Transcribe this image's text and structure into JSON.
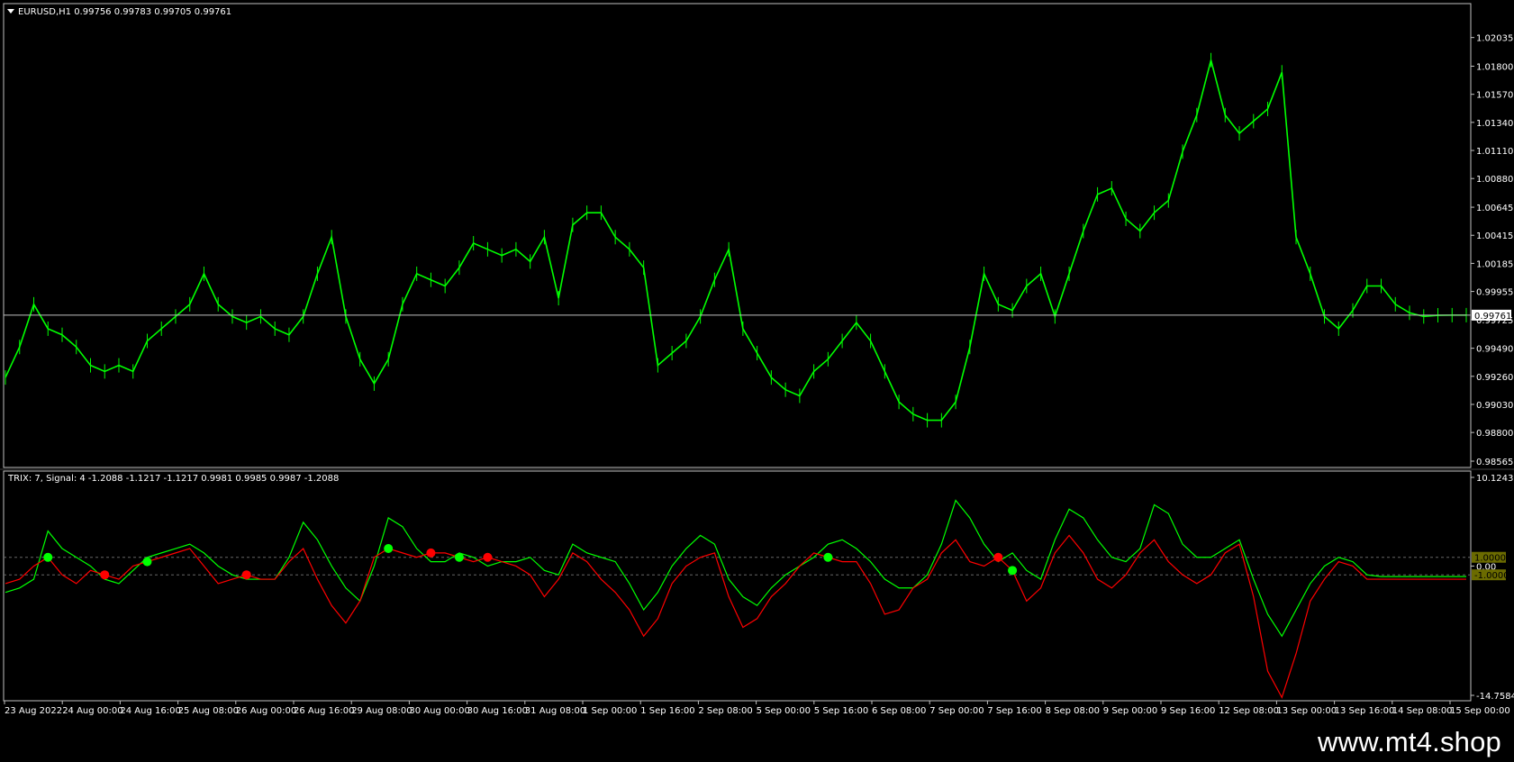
{
  "chart_data": [
    {
      "type": "line",
      "title": "EURUSD,H1  0.99756 0.99783 0.99705 0.99761",
      "symbol": "EURUSD,H1",
      "ohlc": "0.99756 0.99783 0.99705 0.99761",
      "ylim": [
        0.98565,
        1.0218
      ],
      "y_ticks": [
        "1.02035",
        "1.01800",
        "1.01570",
        "1.01340",
        "1.01110",
        "1.00880",
        "1.00645",
        "1.00415",
        "1.00185",
        "0.99955",
        "0.99725",
        "0.99490",
        "0.99260",
        "0.99030",
        "0.98800",
        "0.98565"
      ],
      "current_price": "0.99761",
      "series": [
        {
          "color": "#00ff00",
          "x": [
            "23 Aug 00:00",
            "23 Aug 04:00",
            "23 Aug 08:00",
            "23 Aug 12:00",
            "23 Aug 16:00",
            "23 Aug 20:00",
            "24 Aug 00:00",
            "24 Aug 04:00",
            "24 Aug 08:00",
            "24 Aug 12:00",
            "24 Aug 16:00",
            "24 Aug 20:00",
            "25 Aug 00:00",
            "25 Aug 04:00",
            "25 Aug 08:00",
            "25 Aug 12:00",
            "25 Aug 16:00",
            "25 Aug 20:00",
            "26 Aug 00:00",
            "26 Aug 04:00",
            "26 Aug 08:00",
            "26 Aug 12:00",
            "26 Aug 16:00",
            "26 Aug 20:00",
            "29 Aug 00:00",
            "29 Aug 04:00",
            "29 Aug 08:00",
            "29 Aug 12:00",
            "29 Aug 16:00",
            "29 Aug 20:00",
            "30 Aug 00:00",
            "30 Aug 04:00",
            "30 Aug 08:00",
            "30 Aug 12:00",
            "30 Aug 16:00",
            "30 Aug 20:00",
            "31 Aug 00:00",
            "31 Aug 04:00",
            "31 Aug 08:00",
            "31 Aug 12:00",
            "31 Aug 16:00",
            "31 Aug 20:00",
            "1 Sep 00:00",
            "1 Sep 04:00",
            "1 Sep 08:00",
            "1 Sep 12:00",
            "1 Sep 16:00",
            "1 Sep 20:00",
            "2 Sep 00:00",
            "2 Sep 04:00",
            "2 Sep 08:00",
            "2 Sep 12:00",
            "2 Sep 16:00",
            "2 Sep 20:00",
            "5 Sep 00:00",
            "5 Sep 04:00",
            "5 Sep 08:00",
            "5 Sep 12:00",
            "5 Sep 16:00",
            "5 Sep 20:00",
            "6 Sep 00:00",
            "6 Sep 04:00",
            "6 Sep 08:00",
            "6 Sep 12:00",
            "6 Sep 16:00",
            "6 Sep 20:00",
            "7 Sep 00:00",
            "7 Sep 04:00",
            "7 Sep 08:00",
            "7 Sep 12:00",
            "7 Sep 16:00",
            "7 Sep 20:00",
            "8 Sep 00:00",
            "8 Sep 04:00",
            "8 Sep 08:00",
            "8 Sep 12:00",
            "8 Sep 16:00",
            "8 Sep 20:00",
            "9 Sep 00:00",
            "9 Sep 04:00",
            "9 Sep 08:00",
            "9 Sep 12:00",
            "9 Sep 16:00",
            "9 Sep 20:00",
            "12 Sep 00:00",
            "12 Sep 04:00",
            "12 Sep 08:00",
            "12 Sep 12:00",
            "12 Sep 16:00",
            "12 Sep 20:00",
            "13 Sep 00:00",
            "13 Sep 04:00",
            "13 Sep 08:00",
            "13 Sep 12:00",
            "13 Sep 16:00",
            "13 Sep 20:00",
            "14 Sep 00:00",
            "14 Sep 04:00",
            "14 Sep 08:00",
            "14 Sep 12:00",
            "14 Sep 16:00",
            "14 Sep 20:00",
            "15 Sep 00:00",
            "15 Sep 04:00"
          ],
          "y": [
            0.9925,
            0.995,
            0.9985,
            0.9965,
            0.996,
            0.995,
            0.9935,
            0.993,
            0.9935,
            0.993,
            0.9955,
            0.9965,
            0.9975,
            0.9985,
            1.001,
            0.9985,
            0.9975,
            0.997,
            0.9975,
            0.9965,
            0.996,
            0.9975,
            1.001,
            1.004,
            0.9975,
            0.994,
            0.992,
            0.994,
            0.9985,
            1.001,
            1.0005,
            1.0,
            1.0015,
            1.0035,
            1.003,
            1.0025,
            1.003,
            1.002,
            1.004,
            0.999,
            1.005,
            1.006,
            1.006,
            1.004,
            1.003,
            1.0015,
            0.9935,
            0.9945,
            0.9955,
            0.9975,
            1.0005,
            1.003,
            0.9965,
            0.9945,
            0.9925,
            0.9915,
            0.991,
            0.993,
            0.994,
            0.9955,
            0.997,
            0.9955,
            0.993,
            0.9905,
            0.9895,
            0.989,
            0.989,
            0.9905,
            0.995,
            1.001,
            0.9985,
            0.998,
            1.0,
            1.001,
            0.9975,
            1.001,
            1.0045,
            1.0075,
            1.008,
            1.0055,
            1.0045,
            1.006,
            1.007,
            1.011,
            1.014,
            1.0185,
            1.014,
            1.0125,
            1.0135,
            1.0145,
            1.0175,
            1.004,
            1.001,
            0.9975,
            0.9965,
            0.998,
            1.0,
            1.0,
            0.9985,
            0.9978,
            0.9975,
            0.9976,
            0.99761,
            0.99761
          ]
        }
      ]
    },
    {
      "type": "line",
      "title": "TRIX: 7, Signal: 4 -1.2088 -1.1217 -1.1217 0.9981 0.9985 0.9987 -1.2088",
      "ylim": [
        -14.7584,
        10.1243
      ],
      "y_ticks": [
        "10.1243",
        "0.00",
        "-14.7584"
      ],
      "level_labels": [
        "1.0000",
        "-1.0000"
      ],
      "levels": [
        1.0,
        -1.0
      ],
      "series": [
        {
          "color": "#00ff00",
          "x": [
            0,
            4,
            8,
            12,
            16,
            20,
            24,
            28,
            32,
            36,
            40,
            44,
            48,
            52,
            56,
            60,
            64,
            68,
            72,
            76,
            80,
            84,
            88,
            92,
            96,
            100,
            104,
            108,
            112,
            116,
            120,
            124,
            128,
            132,
            136,
            140,
            144,
            148,
            152,
            156,
            160,
            164,
            168,
            172,
            176,
            180,
            184,
            188,
            192,
            196,
            200,
            204,
            208,
            212,
            216,
            220,
            224,
            228,
            232,
            236,
            240,
            244,
            248,
            252,
            256,
            260,
            264,
            268,
            272,
            276,
            280,
            284,
            288,
            292,
            296,
            300,
            304,
            308,
            312,
            316,
            320,
            324,
            328,
            332,
            336,
            340,
            344,
            348,
            352,
            356,
            360,
            364,
            368,
            372,
            376,
            380,
            384,
            388,
            392,
            396,
            400,
            404,
            408,
            412
          ],
          "y": [
            -3.0,
            -2.5,
            -1.5,
            4.0,
            2.0,
            1.0,
            0.0,
            -1.5,
            -2.0,
            -0.5,
            1.0,
            1.5,
            2.0,
            2.5,
            1.5,
            0.0,
            -1.0,
            -1.5,
            -1.5,
            -1.5,
            1.0,
            5.0,
            3.0,
            0.0,
            -2.5,
            -4.0,
            0.0,
            5.5,
            4.5,
            2.0,
            0.5,
            0.5,
            1.5,
            1.0,
            0.0,
            0.5,
            0.5,
            1.0,
            -0.5,
            -1.0,
            2.5,
            1.5,
            1.0,
            0.5,
            -2.0,
            -5.0,
            -3.0,
            0.0,
            2.0,
            3.5,
            2.5,
            -1.5,
            -3.5,
            -4.5,
            -2.5,
            -1.0,
            0.0,
            1.0,
            2.5,
            3.0,
            2.0,
            0.5,
            -1.5,
            -2.5,
            -2.5,
            -1.0,
            2.5,
            7.5,
            5.5,
            2.5,
            0.5,
            1.5,
            -0.5,
            -1.5,
            3.0,
            6.5,
            5.5,
            3.0,
            1.0,
            0.5,
            2.0,
            7.0,
            6.0,
            2.5,
            1.0,
            1.0,
            2.0,
            3.0,
            -1.5,
            -5.5,
            -8.0,
            -5.0,
            -2.0,
            0.0,
            1.0,
            0.5,
            -1.0,
            -1.2,
            -1.2,
            -1.2,
            -1.2,
            -1.2,
            -1.2,
            -1.2
          ]
        },
        {
          "color": "#ff0000",
          "x": [
            0,
            4,
            8,
            12,
            16,
            20,
            24,
            28,
            32,
            36,
            40,
            44,
            48,
            52,
            56,
            60,
            64,
            68,
            72,
            76,
            80,
            84,
            88,
            92,
            96,
            100,
            104,
            108,
            112,
            116,
            120,
            124,
            128,
            132,
            136,
            140,
            144,
            148,
            152,
            156,
            160,
            164,
            168,
            172,
            176,
            180,
            184,
            188,
            192,
            196,
            200,
            204,
            208,
            212,
            216,
            220,
            224,
            228,
            232,
            236,
            240,
            244,
            248,
            252,
            256,
            260,
            264,
            268,
            272,
            276,
            280,
            284,
            288,
            292,
            296,
            300,
            304,
            308,
            312,
            316,
            320,
            324,
            328,
            332,
            336,
            340,
            344,
            348,
            352,
            356,
            360,
            364,
            368,
            372,
            376,
            380,
            384,
            388,
            392,
            396,
            400,
            404,
            408,
            412
          ],
          "y": [
            -2.0,
            -1.5,
            0.0,
            1.0,
            -1.0,
            -2.0,
            -0.5,
            -1.0,
            -1.5,
            0.0,
            0.5,
            1.0,
            1.5,
            2.0,
            0.0,
            -2.0,
            -1.5,
            -1.0,
            -1.5,
            -1.5,
            0.5,
            2.0,
            -1.5,
            -4.5,
            -6.5,
            -4.0,
            1.0,
            2.0,
            1.5,
            1.0,
            1.5,
            1.5,
            1.0,
            0.5,
            1.0,
            0.5,
            0.0,
            -1.0,
            -3.5,
            -1.5,
            1.5,
            0.5,
            -1.5,
            -3.0,
            -5.0,
            -8.0,
            -6.0,
            -2.0,
            0.0,
            1.0,
            1.5,
            -3.5,
            -7.0,
            -6.0,
            -3.5,
            -2.0,
            0.0,
            1.5,
            1.0,
            0.5,
            0.5,
            -2.0,
            -5.5,
            -5.0,
            -2.5,
            -1.5,
            1.5,
            3.0,
            0.5,
            0.0,
            1.0,
            -0.5,
            -4.0,
            -2.5,
            1.5,
            3.5,
            1.5,
            -1.5,
            -2.5,
            -1.0,
            1.5,
            3.0,
            0.5,
            -1.0,
            -2.0,
            -1.0,
            1.5,
            2.5,
            -3.5,
            -12.0,
            -15.0,
            -10.0,
            -4.0,
            -1.5,
            0.5,
            0.0,
            -1.5,
            -1.5,
            -1.5,
            -1.5,
            -1.5,
            -1.5,
            -1.5,
            -1.5
          ]
        }
      ]
    }
  ],
  "x_axis_labels": [
    "23 Aug 2022",
    "24 Aug 00:00",
    "24 Aug 16:00",
    "25 Aug 08:00",
    "26 Aug 00:00",
    "26 Aug 16:00",
    "29 Aug 08:00",
    "30 Aug 00:00",
    "30 Aug 16:00",
    "31 Aug 08:00",
    "1 Sep 00:00",
    "1 Sep 16:00",
    "2 Sep 08:00",
    "5 Sep 00:00",
    "5 Sep 16:00",
    "6 Sep 08:00",
    "7 Sep 00:00",
    "7 Sep 16:00",
    "8 Sep 08:00",
    "9 Sep 00:00",
    "9 Sep 16:00",
    "12 Sep 08:00",
    "13 Sep 00:00",
    "13 Sep 16:00",
    "14 Sep 08:00",
    "15 Sep 00:00"
  ],
  "watermark": "www.mt4.shop",
  "colors": {
    "background": "#000000",
    "price": "#00ff00",
    "grid": "#c0c0c0",
    "level": "#666666",
    "level_tag": "#6b6b00",
    "dot_green": "#00ff00",
    "dot_red": "#ff0000"
  }
}
